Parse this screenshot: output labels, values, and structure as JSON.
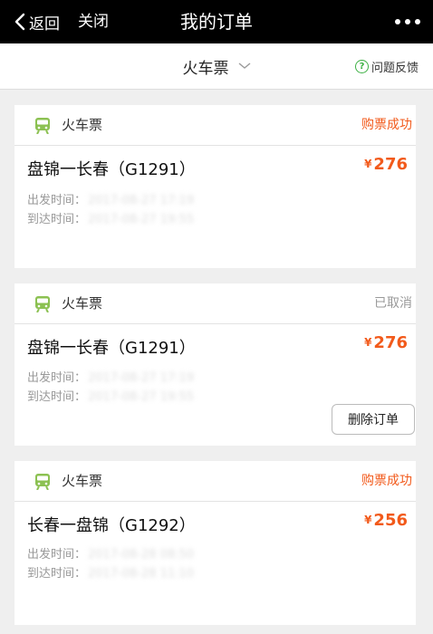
{
  "nav": {
    "back_label": "返回",
    "close_label": "关闭",
    "title": "我的订单"
  },
  "filter": {
    "selected": "火车票",
    "feedback_label": "问题反馈",
    "feedback_icon": "?"
  },
  "colors": {
    "accent_orange": "#f25a1b",
    "train_icon_green": "#8cc152",
    "cancelled_gray": "#999999"
  },
  "orders": [
    {
      "type": "火车票",
      "status": "购票成功",
      "status_color": "#f25a1b",
      "route": "盘锦一长春（G1291）",
      "price_symbol": "¥",
      "price": "276",
      "depart_label": "出发时间：",
      "depart_value": "2017-08-27 17:19",
      "arrive_label": "到达时间：",
      "arrive_value": "2017-08-27 19:55"
    },
    {
      "type": "火车票",
      "status": "已取消",
      "status_color": "#999999",
      "route": "盘锦一长春（G1291）",
      "price_symbol": "¥",
      "price": "276",
      "depart_label": "出发时间：",
      "depart_value": "2017-08-27 17:19",
      "arrive_label": "到达时间：",
      "arrive_value": "2017-08-27 19:55",
      "delete_label": "删除订单"
    },
    {
      "type": "火车票",
      "status": "购票成功",
      "status_color": "#f25a1b",
      "route": "长春一盘锦（G1292）",
      "price_symbol": "¥",
      "price": "256",
      "depart_label": "出发时间：",
      "depart_value": "2017-08-28 08:50",
      "arrive_label": "到达时间：",
      "arrive_value": "2017-08-28 11:10"
    }
  ]
}
